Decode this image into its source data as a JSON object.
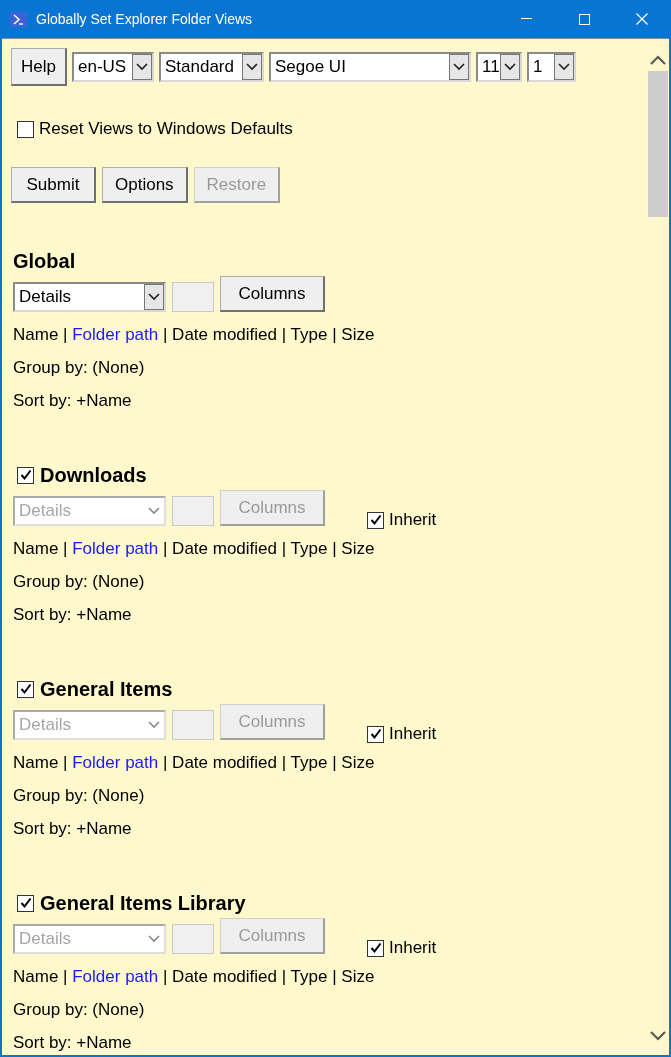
{
  "window": {
    "title": "Globally Set Explorer Folder Views"
  },
  "toolbar": {
    "help_button": "Help",
    "dropdowns": [
      {
        "kind": "language",
        "value": "en-US"
      },
      {
        "kind": "style",
        "value": "Standard"
      },
      {
        "kind": "font",
        "value": "Segoe UI"
      },
      {
        "kind": "size",
        "value": "11"
      },
      {
        "kind": "count",
        "value": "1"
      }
    ]
  },
  "reset_option": {
    "label": "Reset Views to Windows Defaults",
    "checked": false
  },
  "actions": [
    {
      "label": "Submit",
      "disabled": false
    },
    {
      "label": "Options",
      "disabled": false
    },
    {
      "label": "Restore",
      "disabled": true
    }
  ],
  "sections": [
    {
      "kind": "global",
      "title": "Global",
      "view": {
        "value": "Details",
        "disabled": false
      },
      "columns_button": {
        "label": "Columns",
        "disabled": false
      },
      "columns": {
        "separator": "|",
        "items": [
          {
            "label": "Name",
            "highlighted": false
          },
          {
            "label": "Folder path",
            "highlighted": true
          },
          {
            "label": "Date modified",
            "highlighted": false
          },
          {
            "label": "Type",
            "highlighted": false
          },
          {
            "label": "Size",
            "highlighted": false
          }
        ]
      },
      "group_by": "Group by: (None)",
      "sort_by": "Sort by: +Name"
    },
    {
      "kind": "folder",
      "title": "Downloads",
      "checked": true,
      "view": {
        "value": "Details",
        "disabled": true
      },
      "columns_button": {
        "label": "Columns",
        "disabled": true
      },
      "inherit": {
        "label": "Inherit",
        "checked": true
      },
      "columns": {
        "separator": "|",
        "items": [
          {
            "label": "Name",
            "highlighted": false
          },
          {
            "label": "Folder path",
            "highlighted": true
          },
          {
            "label": "Date modified",
            "highlighted": false
          },
          {
            "label": "Type",
            "highlighted": false
          },
          {
            "label": "Size",
            "highlighted": false
          }
        ]
      },
      "group_by": "Group by: (None)",
      "sort_by": "Sort by: +Name"
    },
    {
      "kind": "folder",
      "title": "General Items",
      "checked": true,
      "view": {
        "value": "Details",
        "disabled": true
      },
      "columns_button": {
        "label": "Columns",
        "disabled": true
      },
      "inherit": {
        "label": "Inherit",
        "checked": true
      },
      "columns": {
        "separator": "|",
        "items": [
          {
            "label": "Name",
            "highlighted": false
          },
          {
            "label": "Folder path",
            "highlighted": true
          },
          {
            "label": "Date modified",
            "highlighted": false
          },
          {
            "label": "Type",
            "highlighted": false
          },
          {
            "label": "Size",
            "highlighted": false
          }
        ]
      },
      "group_by": "Group by: (None)",
      "sort_by": "Sort by: +Name"
    },
    {
      "kind": "folder",
      "title": "General Items Library",
      "checked": true,
      "view": {
        "value": "Details",
        "disabled": true
      },
      "columns_button": {
        "label": "Columns",
        "disabled": true
      },
      "inherit": {
        "label": "Inherit",
        "checked": true
      },
      "columns": {
        "separator": "|",
        "items": [
          {
            "label": "Name",
            "highlighted": false
          },
          {
            "label": "Folder path",
            "highlighted": true
          },
          {
            "label": "Date modified",
            "highlighted": false
          },
          {
            "label": "Type",
            "highlighted": false
          },
          {
            "label": "Size",
            "highlighted": false
          }
        ]
      },
      "group_by": "Group by: (None)",
      "sort_by": "Sort by: +Name"
    }
  ]
}
